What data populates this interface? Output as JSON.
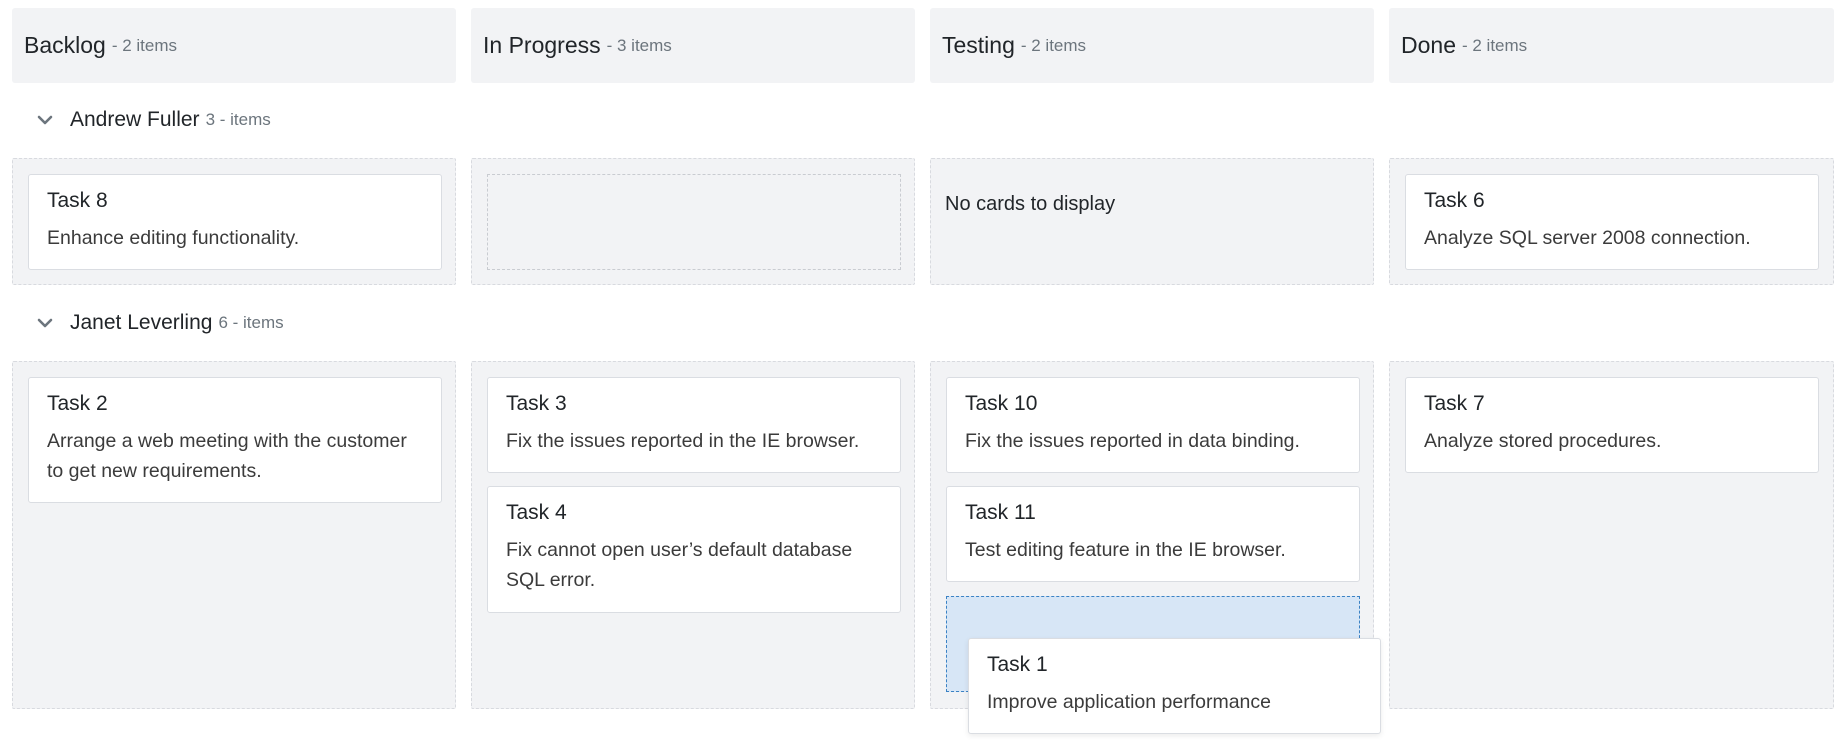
{
  "columns": [
    {
      "title": "Backlog",
      "count": "- 2 items"
    },
    {
      "title": "In Progress",
      "count": "- 3 items"
    },
    {
      "title": "Testing",
      "count": "- 2 items"
    },
    {
      "title": "Done",
      "count": "- 2 items"
    }
  ],
  "swimlanes": [
    {
      "name": "Andrew Fuller",
      "count": "3 - items"
    },
    {
      "name": "Janet Leverling",
      "count": "6 - items"
    }
  ],
  "empty_message": "No cards to display",
  "cards": {
    "task8": {
      "title": "Task 8",
      "desc": "Enhance editing functionality."
    },
    "task6": {
      "title": "Task 6",
      "desc": "Analyze SQL server 2008 connection."
    },
    "task2": {
      "title": "Task 2",
      "desc": "Arrange a web meeting with the customer to get new requirements."
    },
    "task3": {
      "title": "Task 3",
      "desc": "Fix the issues reported in the IE browser."
    },
    "task4": {
      "title": "Task 4",
      "desc": "Fix cannot open user’s default database SQL error."
    },
    "task10": {
      "title": "Task 10",
      "desc": "Fix the issues reported in data binding."
    },
    "task11": {
      "title": "Task 11",
      "desc": "Test editing feature in the IE browser."
    },
    "task7": {
      "title": "Task 7",
      "desc": "Analyze stored procedures."
    },
    "task1": {
      "title": "Task 1",
      "desc": "Improve application performance"
    }
  },
  "colors": {
    "header_bg": "#f2f3f5",
    "cell_bg": "#f2f3f5",
    "drop_target_bg": "#d7e6f6",
    "drop_target_border": "#3b82c4"
  }
}
